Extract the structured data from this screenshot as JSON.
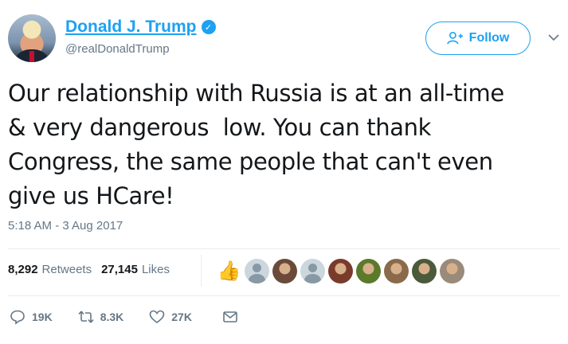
{
  "author": {
    "display_name": "Donald J. Trump",
    "handle": "@realDonaldTrump",
    "verified": true,
    "avatar_icon": "profile-photo"
  },
  "header": {
    "follow_label": "Follow",
    "follow_icon": "add-user-icon",
    "menu_icon": "chevron-down-icon"
  },
  "tweet": {
    "text": "Our relationship with Russia is at an all-time\n& very dangerous  low. You can thank\nCongress, the same people that can't even\ngive us HCare!",
    "timestamp": "5:18 AM - 3 Aug 2017"
  },
  "stats": {
    "retweets_count": "8,292",
    "retweets_label": "Retweets",
    "likes_count": "27,145",
    "likes_label": "Likes"
  },
  "likers": [
    {
      "icon": "thumbs-up-emoji"
    },
    {
      "icon": "default-avatar"
    },
    {
      "icon": "profile-photo",
      "color": "#6b4a3a"
    },
    {
      "icon": "default-avatar"
    },
    {
      "icon": "profile-photo",
      "color": "#7a3b2a"
    },
    {
      "icon": "profile-photo",
      "color": "#5c7a2a"
    },
    {
      "icon": "profile-photo",
      "color": "#8a6a4a"
    },
    {
      "icon": "profile-photo",
      "color": "#4a5a3a"
    },
    {
      "icon": "profile-photo",
      "color": "#9a8a7a"
    }
  ],
  "actions": {
    "reply_count": "19K",
    "retweet_count": "8.3K",
    "like_count": "27K",
    "dm_icon": "envelope-icon"
  },
  "colors": {
    "brand_blue": "#1da1f2",
    "secondary_text": "#657786",
    "primary_text": "#14171a",
    "divider": "#e6ecf0"
  }
}
